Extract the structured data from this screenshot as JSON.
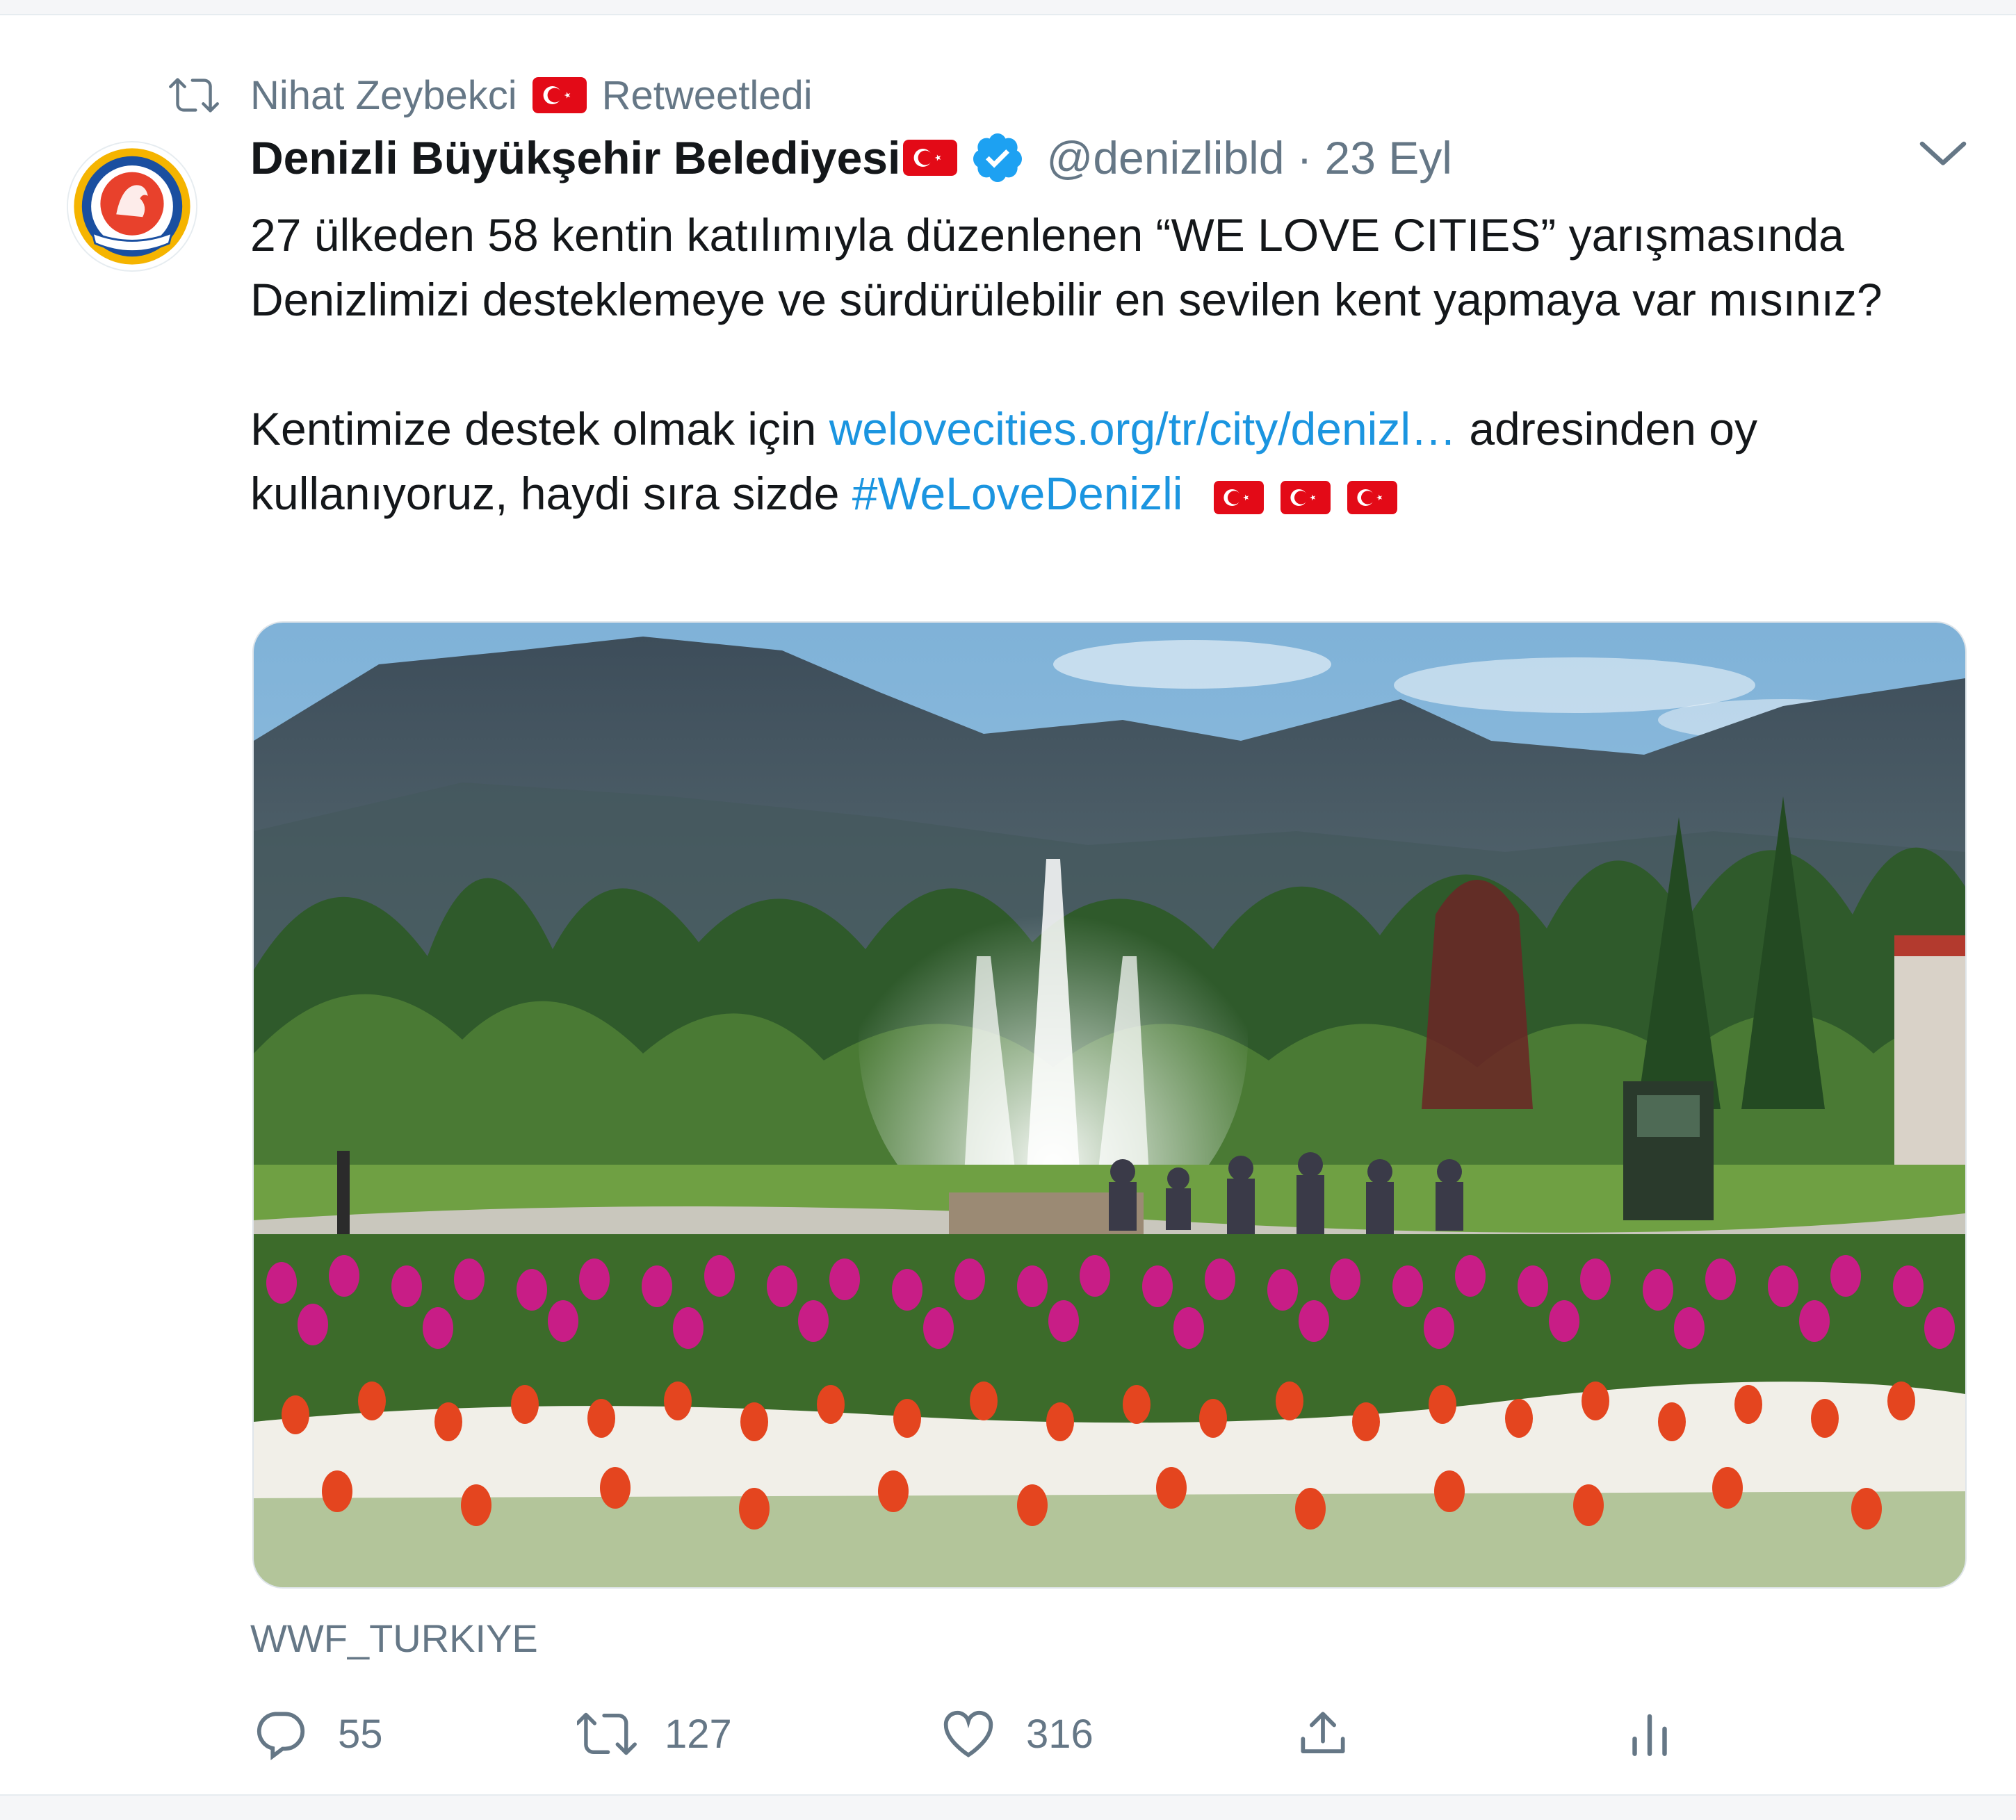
{
  "retweet": {
    "user": "Nihat Zeybekci",
    "label": "Retweetledi",
    "icon": "retweet-icon"
  },
  "tweet": {
    "display_name": "Denizli Büyükşehir Belediyesi",
    "handle": "@denizlibld",
    "separator": "·",
    "date": "23 Eyl",
    "verified_icon": "verified-badge-icon",
    "line1": "27 ülkeden 58 kentin katılımıyla düzenlenen “WE LOVE CITIES” yarışmasında Denizlimizi desteklemeye ve sürdürülebilir en sevilen kent yapmaya var mısınız?",
    "line2_prefix": "Kentimize destek olmak için",
    "link": "welovecities.org/tr/city/denizl…",
    "line2_suffix": "adresinden oy kullanıyoruz, haydi sıra sizde",
    "hashtag": "#WeLoveDenizli"
  },
  "media": {
    "credit": "WWF_TURKIYE"
  },
  "actions": {
    "replies": "55",
    "retweets": "127",
    "likes": "316"
  },
  "colors": {
    "link": "#1b95e0",
    "muted": "#657786",
    "flag_red": "#e30a17",
    "verified": "#1da1f2"
  }
}
